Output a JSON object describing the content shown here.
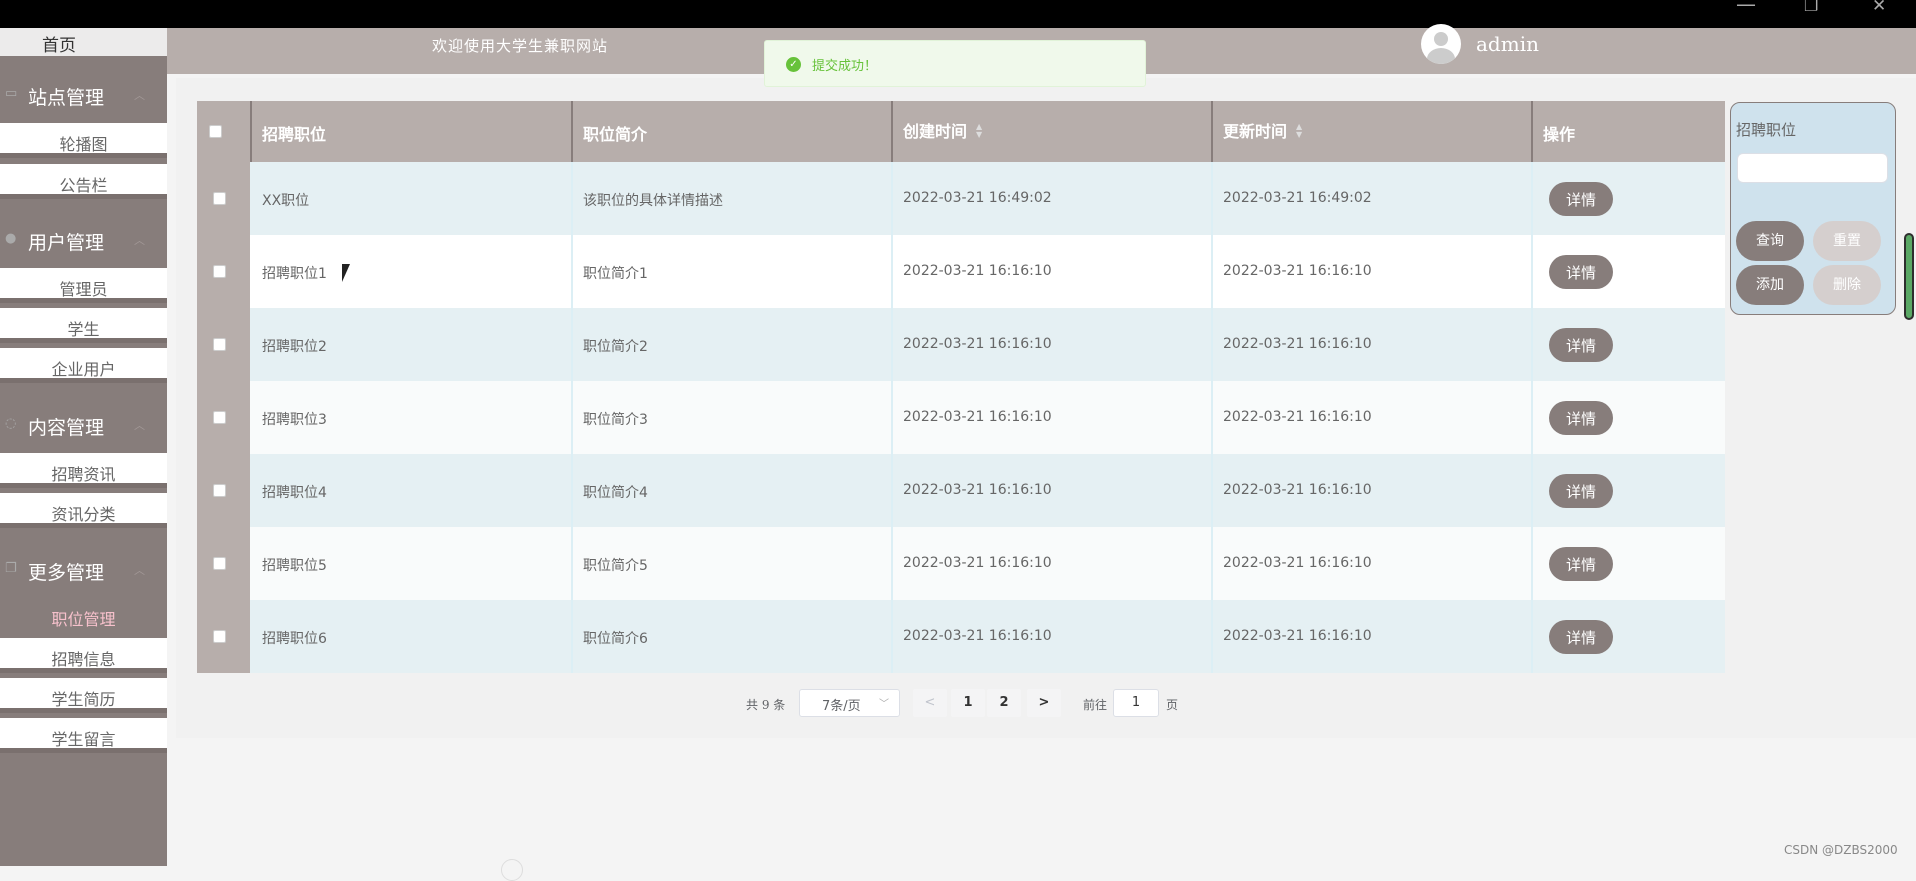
{
  "window": {
    "minimize": "—",
    "restore": "❐",
    "close": "✕"
  },
  "sidebar": {
    "home": "首页",
    "groups": [
      {
        "label": "站点管理",
        "icon": "monitor-icon",
        "items": [
          "轮播图",
          "公告栏"
        ]
      },
      {
        "label": "用户管理",
        "icon": "user-icon",
        "items": [
          "管理员",
          "学生",
          "企业用户"
        ]
      },
      {
        "label": "内容管理",
        "icon": "chat-icon",
        "items": [
          "招聘资讯",
          "资讯分类"
        ]
      },
      {
        "label": "更多管理",
        "icon": "copy-icon",
        "items": [
          "职位管理",
          "招聘信息",
          "学生简历",
          "学生留言"
        ]
      }
    ],
    "active_item": "职位管理"
  },
  "header": {
    "welcome": "欢迎使用大学生兼职网站",
    "username": "admin"
  },
  "toast": {
    "message": "提交成功！",
    "icon": "check-circle-icon"
  },
  "table": {
    "columns": [
      "招聘职位",
      "职位简介",
      "创建时间",
      "更新时间",
      "操作"
    ],
    "rows": [
      {
        "title": "XX职位",
        "intro": "该职位的具体详情描述",
        "created": "2022-03-21 16:49:02",
        "updated": "2022-03-21 16:49:02",
        "action": "详情"
      },
      {
        "title": "招聘职位1",
        "intro": "职位简介1",
        "created": "2022-03-21 16:16:10",
        "updated": "2022-03-21 16:16:10",
        "action": "详情"
      },
      {
        "title": "招聘职位2",
        "intro": "职位简介2",
        "created": "2022-03-21 16:16:10",
        "updated": "2022-03-21 16:16:10",
        "action": "详情"
      },
      {
        "title": "招聘职位3",
        "intro": "职位简介3",
        "created": "2022-03-21 16:16:10",
        "updated": "2022-03-21 16:16:10",
        "action": "详情"
      },
      {
        "title": "招聘职位4",
        "intro": "职位简介4",
        "created": "2022-03-21 16:16:10",
        "updated": "2022-03-21 16:16:10",
        "action": "详情"
      },
      {
        "title": "招聘职位5",
        "intro": "职位简介5",
        "created": "2022-03-21 16:16:10",
        "updated": "2022-03-21 16:16:10",
        "action": "详情"
      },
      {
        "title": "招聘职位6",
        "intro": "职位简介6",
        "created": "2022-03-21 16:16:10",
        "updated": "2022-03-21 16:16:10",
        "action": "详情"
      }
    ]
  },
  "pagination": {
    "total": "共 9 条",
    "page_size": "7条/页",
    "pages": [
      "1",
      "2"
    ],
    "goto_label": "前往",
    "goto_value": "1",
    "page_suffix": "页"
  },
  "search": {
    "label": "招聘职位",
    "value": "",
    "query": "查询",
    "reset": "重置",
    "add": "添加",
    "delete": "删除"
  },
  "watermark": "CSDN @DZBS2000"
}
